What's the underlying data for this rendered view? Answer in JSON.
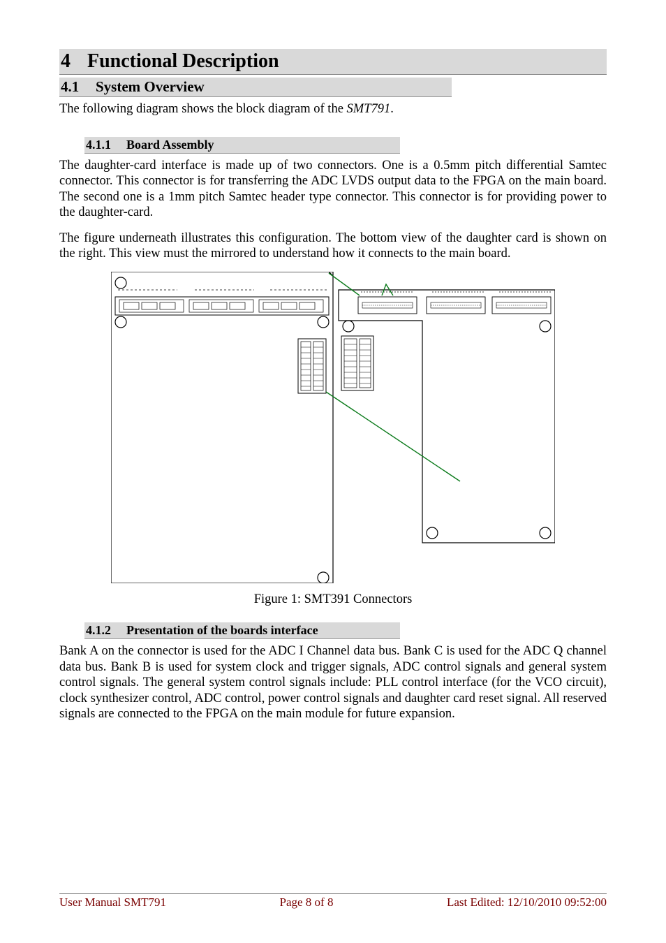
{
  "headings": {
    "h1": {
      "num": "4",
      "text": "Functional Description"
    },
    "h2": {
      "num": "4.1",
      "text": "System Overview"
    },
    "h3a": {
      "num": "4.1.1",
      "text": "Board Assembly"
    },
    "h3b": {
      "num": "4.1.2",
      "text": "Presentation of the boards interface"
    }
  },
  "paragraphs": {
    "intro_a": "The following diagram shows the block diagram of the ",
    "intro_b": "SMT791",
    "intro_c": ".",
    "assembly1": "The daughter-card interface is made up of two connectors. One is a 0.5mm pitch differential Samtec connector. This connector is for transferring the ADC LVDS output data to the FPGA on the main board. The second one is a 1mm pitch Samtec header type connector. This connector is for providing power to the daughter-card.",
    "assembly2": "The figure underneath illustrates this configuration. The bottom view of the daughter card is shown on the right. This view must the mirrored to understand how it connects to the main board.",
    "presentation1": "Bank A on the connector is used for the ADC I Channel data bus. Bank C is used for the ADC Q channel data bus. Bank B is used for system clock and trigger signals, ADC control signals and general system control signals. The general system control signals include: PLL control interface (for the VCO circuit), clock synthesizer control, ADC control, power control signals and daughter card reset signal. All reserved signals are connected to the FPGA on the main module for future expansion."
  },
  "figure": {
    "caption": "Figure 1: SMT391 Connectors"
  },
  "footer": {
    "left": "User Manual SMT791",
    "center": "Page 8 of 8",
    "right": "Last Edited: 12/10/2010 09:52:00"
  }
}
